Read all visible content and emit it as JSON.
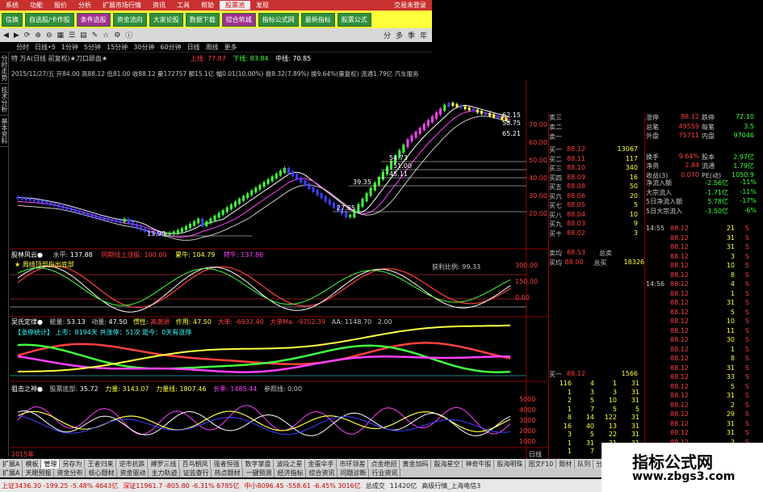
{
  "menu": [
    "系统",
    "功能",
    "报价",
    "分析",
    "扩展市场行情",
    "资讯",
    "工具",
    "帮助",
    "股票池",
    "发现"
  ],
  "menu_right": "交易未登录",
  "ribbon": [
    "信换",
    "自选股/卡作股",
    "条件选股",
    "资金流向",
    "大家论股",
    "数据下载",
    "综合筑城",
    "指标公式网",
    "最新指标",
    "股票公式"
  ],
  "toolbar_right": [
    "分",
    "多",
    "季",
    "年"
  ],
  "periods": [
    "分时",
    "日线•5",
    "1分钟",
    "5分钟",
    "15分钟",
    "30分钟",
    "60分钟",
    "日线",
    "周线",
    "更多"
  ],
  "sidetabs": [
    "分时走势",
    "技术分析",
    "基本资料"
  ],
  "chart_head": {
    "line1": "特  万A(日线 前复权)★刀口舔血★",
    "up_label": "上线:",
    "up_val": "77.87",
    "down_label": "下线:",
    "down_val": "83.84",
    "mid_label": "中线:",
    "mid_val": "70.85",
    "line2": "2015/11/27/五 开84.00 高88.12 低81.00 收88.12 量172757 额15.1亿 幅0.01(10.00%) 振8.32(7.89%) 换9.64%(量复权) 流通1.79亿 汽车服务"
  },
  "price_axis": [
    "70.00",
    "60.00",
    "50.00",
    "40.00",
    "30.00",
    "20.00"
  ],
  "annotations": [
    "54.73",
    "51.00",
    "45.11",
    "39.35",
    "27.65",
    "13.90",
    "62.15",
    "58.75",
    "65.21"
  ],
  "ind1": {
    "name": "股林风云●",
    "l1": "水平:",
    "v1": "137.88",
    "l2": "同期线上涨股:",
    "v2": "100.00",
    "l3": "累牛:",
    "v3": "104.79",
    "l4": "转牛:",
    "v4": "137.86",
    "note": "获利比例:",
    "note_v": "99.33",
    "legend": "★ 周线顶部指出底部",
    "axis": [
      "300.00",
      "150.00",
      "0.00"
    ]
  },
  "ind2": {
    "name": "吴氏定律●",
    "l1": "能量:",
    "v1": "53.13",
    "l2": "动量:",
    "v2": "47.50",
    "l3": "惯性:",
    "v3": "高潮退",
    "l4": "作用:",
    "v4": "47.50",
    "l5": "大单:",
    "v5": "-6932.40",
    "l6": "大单Ma:",
    "v6": "-9752.39",
    "l7": "AA:",
    "v7": "1148.70",
    "l8": "2.00",
    "sub": "【涨停统计】 上市：8194天  共涨停：51次  距今：0天有涨停"
  },
  "ind3": {
    "name": "狙击之神●",
    "l1": "股票底部:",
    "v1": "35.72",
    "l2": "力量:",
    "v2": "3143.07",
    "l3": "力量线:",
    "v3": "1807.46",
    "l4": "长季:",
    "v4": "1485.44",
    "l5": "参照线:",
    "v5": "0.00",
    "axis": [
      "5000",
      "4000",
      "3000",
      "2000",
      "1000"
    ]
  },
  "orderbook_sell": [
    {
      "lbl": "卖三",
      "px": "",
      "vol": ""
    },
    {
      "lbl": "卖二",
      "px": "",
      "vol": ""
    },
    {
      "lbl": "卖一",
      "px": "",
      "vol": ""
    }
  ],
  "orderbook_buy": [
    {
      "lbl": "买一",
      "px": "88.12",
      "vol": "13067"
    },
    {
      "lbl": "买二",
      "px": "88.11",
      "vol": "117"
    },
    {
      "lbl": "买三",
      "px": "88.10",
      "vol": "340"
    },
    {
      "lbl": "买四",
      "px": "88.09",
      "vol": "16"
    },
    {
      "lbl": "买五",
      "px": "88.08",
      "vol": "50"
    },
    {
      "lbl": "买六",
      "px": "88.06",
      "vol": "20"
    },
    {
      "lbl": "买七",
      "px": "88.05",
      "vol": "5"
    },
    {
      "lbl": "买八",
      "px": "88.04",
      "vol": "10"
    },
    {
      "lbl": "买九",
      "px": "88.03",
      "vol": "9"
    },
    {
      "lbl": "买十",
      "px": "88.02",
      "vol": "3"
    }
  ],
  "ob_bottom": {
    "l1": "卖均",
    "v1": "88.53",
    "l2": "总卖",
    "v2": "",
    "l3": "买均",
    "v3": "88.00",
    "l4": "总买",
    "v4": "18326"
  },
  "stats": [
    {
      "k": "涨停",
      "v1": "88.12",
      "k2": "跌停",
      "v2": "72.10"
    },
    {
      "k": "总笔",
      "v1": "49559",
      "k2": "每笔",
      "v2": "3.5"
    },
    {
      "k": "外盘",
      "v1": "75711",
      "k2": "内盘",
      "v2": "97046"
    },
    {
      "k": "换手",
      "v1": "9.64%",
      "k2": "股本",
      "v2": "2.97亿"
    },
    {
      "k": "净资",
      "v1": "2.84",
      "k2": "流通",
      "v2": "1.79亿"
    },
    {
      "k": "收益(3)",
      "v1": "0.070",
      "k2": "PE(动)",
      "v2": "1050.9"
    }
  ],
  "flows": [
    {
      "k": "净流入额",
      "v": "-2.56亿",
      "p": "-11%"
    },
    {
      "k": "大宗流入",
      "v": "-1.71亿",
      "p": "-11%"
    },
    {
      "k": "5日净流入额",
      "v": "5.78亿",
      "p": "-17%"
    },
    {
      "k": "5日大宗流入",
      "v": "-3.50亿",
      "p": "-6%"
    }
  ],
  "ticks": [
    {
      "t": "14:55",
      "p": "88.12",
      "q": "21",
      "s": "S"
    },
    {
      "t": "",
      "p": "88.12",
      "q": "31",
      "s": "S"
    },
    {
      "t": "",
      "p": "88.12",
      "q": "31",
      "s": "S"
    },
    {
      "t": "",
      "p": "88.12",
      "q": "3",
      "s": "S"
    },
    {
      "t": "",
      "p": "88.12",
      "q": "10",
      "s": "S"
    },
    {
      "t": "",
      "p": "88.12",
      "q": "8",
      "s": "S"
    },
    {
      "t": "14:56",
      "p": "88.12",
      "q": "4",
      "s": "S"
    },
    {
      "t": "",
      "p": "88.12",
      "q": "1",
      "s": "S"
    },
    {
      "t": "",
      "p": "88.12",
      "q": "31",
      "s": "S"
    },
    {
      "t": "",
      "p": "88.12",
      "q": "5",
      "s": "S"
    },
    {
      "t": "",
      "p": "88.12",
      "q": "10",
      "s": "S"
    },
    {
      "t": "",
      "p": "88.12",
      "q": "11",
      "s": "S"
    },
    {
      "t": "",
      "p": "88.12",
      "q": "30",
      "s": "S"
    },
    {
      "t": "",
      "p": "88.12",
      "q": "1",
      "s": "S"
    },
    {
      "t": "",
      "p": "88.12",
      "q": "8",
      "s": "S"
    },
    {
      "t": "",
      "p": "88.12",
      "q": "31",
      "s": "S"
    },
    {
      "t": "",
      "p": "88.12",
      "q": "33",
      "s": "S"
    },
    {
      "t": "",
      "p": "88.12",
      "q": "5",
      "s": "S"
    },
    {
      "t": "",
      "p": "88.12",
      "q": "31",
      "s": "S"
    },
    {
      "t": "",
      "p": "88.12",
      "q": "2",
      "s": "S"
    },
    {
      "t": "",
      "p": "88.12",
      "q": "29",
      "s": "S"
    },
    {
      "t": "",
      "p": "88.12",
      "q": "31",
      "s": "S"
    },
    {
      "t": "",
      "p": "88.12",
      "q": "31",
      "s": "S"
    },
    {
      "t": "",
      "p": "88.12",
      "q": "3",
      "s": "S"
    }
  ],
  "minor_table_head": {
    "l": "买一",
    "p": "88.12",
    "v": "1566"
  },
  "minor_table": [
    [
      "116",
      "4",
      "1",
      "31"
    ],
    [
      "1",
      "3",
      "3",
      "31"
    ],
    [
      "2",
      "5",
      "10",
      "31"
    ],
    [
      "1",
      "7",
      "5",
      "5"
    ],
    [
      "8",
      "14",
      "122",
      "31"
    ],
    [
      "16",
      "40",
      "13",
      "31"
    ],
    [
      "3",
      "5",
      "22",
      "31"
    ],
    [
      "1",
      "31",
      "31",
      "31"
    ],
    [
      "1",
      "7",
      "31",
      "31"
    ]
  ],
  "btabs": [
    "扩展A",
    "模板",
    "管理",
    "另存为",
    "王者归来",
    "逆市抗跌",
    "搏罗三线",
    "百鸟朝凤",
    "强者恒强",
    "数字掌盘",
    "波段之星",
    "金蛋伞手",
    "市环领差",
    "点金绝招",
    "黄金加码",
    "殷海星空",
    "神奇牛股",
    "股海明珠",
    "图文F10",
    "题材",
    "队列",
    "分笔",
    "龙虎"
  ],
  "btabs2": [
    "扩展A",
    "天眼预报",
    "资金分布",
    "核心题材",
    "资金驱动",
    "主力轨迹",
    "证监查行",
    "热点题材",
    "一键预测",
    "经济指标",
    "综合资讯",
    "问题诊断",
    "行业资讯"
  ],
  "status": [
    {
      "t": "上证3436.30 -199.25 -5.48% 4643亿",
      "c": "r"
    },
    {
      "t": "深证11961.7 -805.80 -6.31% 6785亿",
      "c": "r"
    },
    {
      "t": "中小8096.45 -558.61 -6.45% 3016亿",
      "c": "r"
    },
    {
      "t": "总成交",
      "c": ""
    },
    {
      "t": "11420亿",
      "c": ""
    },
    {
      "t": "高级行情_上海电信3",
      "c": ""
    }
  ],
  "year_label": "2015年",
  "day_label": "日线",
  "watermark": {
    "t1": "指标公式网",
    "t2": "www.zbgs3.com"
  },
  "colors": {
    "up": "#ff4040",
    "down": "#40ff40",
    "blue": "#4040ff",
    "yellow": "#ffff40",
    "magenta": "#ff40ff"
  }
}
